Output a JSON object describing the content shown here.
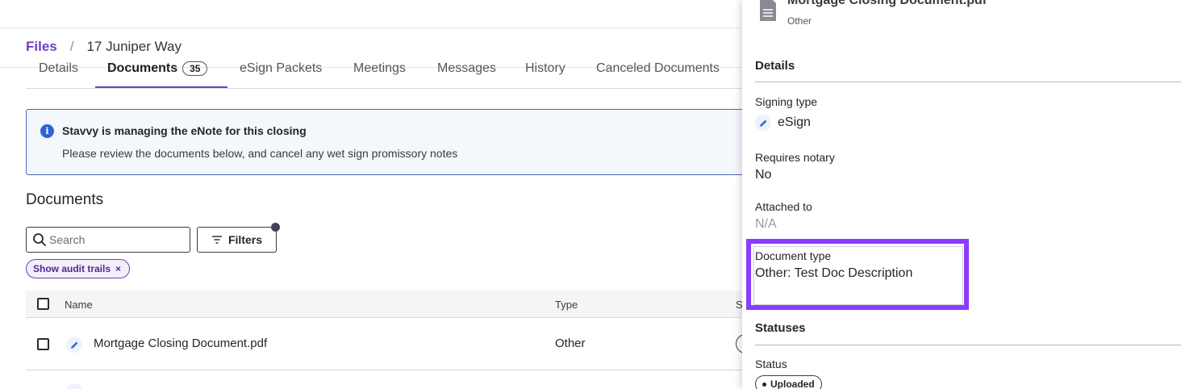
{
  "breadcrumb": {
    "root": "Files",
    "separator": "/",
    "current": "17 Juniper Way"
  },
  "tabs": [
    {
      "label": "Details"
    },
    {
      "label": "Documents",
      "badge": "35",
      "active": true
    },
    {
      "label": "eSign Packets"
    },
    {
      "label": "Meetings"
    },
    {
      "label": "Messages"
    },
    {
      "label": "History"
    },
    {
      "label": "Canceled Documents"
    }
  ],
  "banner": {
    "icon": "info-icon",
    "title": "Stavvy is managing the eNote for this closing",
    "text": "Please review the documents below, and cancel any wet sign promissory notes"
  },
  "documents": {
    "title": "Documents",
    "search_placeholder": "Search",
    "filters_label": "Filters",
    "chip_label": "Show audit trails",
    "chip_close": "×",
    "columns": {
      "name": "Name",
      "type": "Type",
      "status": "S"
    },
    "rows": [
      {
        "name": "Mortgage Closing Document.pdf",
        "type": "Other"
      }
    ]
  },
  "panel": {
    "doc_title": "Mortgage Closing Document.pdf",
    "doc_subtitle": "Other",
    "details_heading": "Details",
    "signing_type_label": "Signing type",
    "signing_type_value": "eSign",
    "requires_notary_label": "Requires notary",
    "requires_notary_value": "No",
    "attached_to_label": "Attached to",
    "attached_to_value": "N/A",
    "document_type_label": "Document type",
    "document_type_value": "Other: Test Doc Description",
    "statuses_heading": "Statuses",
    "status_label": "Status",
    "status_value": "Uploaded"
  },
  "colors": {
    "accent": "#6e3fc2",
    "highlight": "#8b3dff",
    "info": "#2f63d1"
  }
}
